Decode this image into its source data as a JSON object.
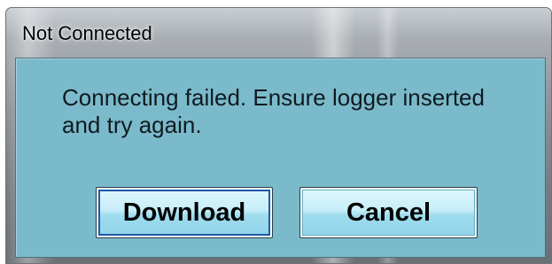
{
  "window": {
    "title": "Not Connected"
  },
  "dialog": {
    "message": "Connecting failed. Ensure logger inserted and try again.",
    "buttons": {
      "download_label": "Download",
      "cancel_label": "Cancel"
    }
  },
  "colors": {
    "client_background": "#7bbacb",
    "button_face": "#c8eef9"
  }
}
